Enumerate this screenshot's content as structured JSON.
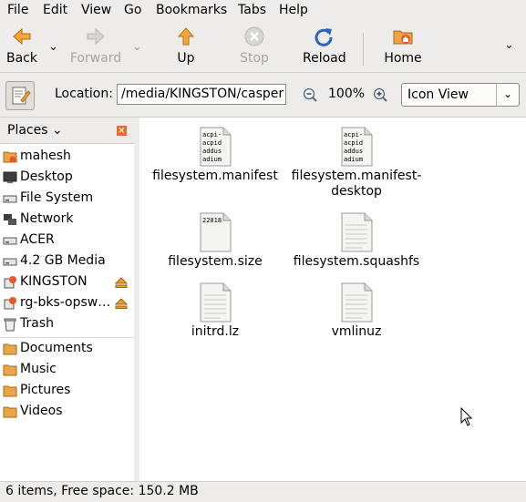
{
  "menubar": {
    "items": [
      "File",
      "Edit",
      "View",
      "Go",
      "Bookmarks",
      "Tabs",
      "Help"
    ]
  },
  "toolbar": {
    "back": "Back",
    "forward": "Forward",
    "up": "Up",
    "stop": "Stop",
    "reload": "Reload",
    "home": "Home"
  },
  "location": {
    "label": "Location:",
    "path": "/media/KINGSTON/casper",
    "zoom": "100%",
    "view_mode": "Icon View"
  },
  "sidebar": {
    "title": "Places",
    "items": [
      {
        "label": "mahesh",
        "icon": "home-folder-icon"
      },
      {
        "label": "Desktop",
        "icon": "desktop-icon"
      },
      {
        "label": "File System",
        "icon": "drive-icon"
      },
      {
        "label": "Network",
        "icon": "network-icon"
      },
      {
        "label": "ACER",
        "icon": "drive-icon"
      },
      {
        "label": "4.2 GB Media",
        "icon": "drive-icon"
      },
      {
        "label": "KINGSTON",
        "icon": "usb-drive-icon"
      },
      {
        "label": "rg-bks-opsw…",
        "icon": "usb-drive-icon"
      },
      {
        "label": "Trash",
        "icon": "trash-icon"
      },
      {
        "label": "Documents",
        "icon": "folder-icon"
      },
      {
        "label": "Music",
        "icon": "folder-icon"
      },
      {
        "label": "Pictures",
        "icon": "folder-icon"
      },
      {
        "label": "Videos",
        "icon": "folder-icon"
      }
    ]
  },
  "files": [
    {
      "name": "filesystem.manifest",
      "preview": [
        "acpi-",
        "acpid",
        "addus",
        "adium"
      ]
    },
    {
      "name": "filesystem.manifest-desktop",
      "name_line1": "filesystem.manifest-",
      "name_line2": "desktop",
      "preview": [
        "acpi-",
        "acpid",
        "addus",
        "adium"
      ]
    },
    {
      "name": "filesystem.size",
      "preview": [
        "22018"
      ]
    },
    {
      "name": "filesystem.squashfs",
      "preview": []
    },
    {
      "name": "initrd.lz",
      "preview": []
    },
    {
      "name": "vmlinuz",
      "preview": []
    }
  ],
  "status": {
    "text": "6 items, Free space: 150.2 MB"
  }
}
